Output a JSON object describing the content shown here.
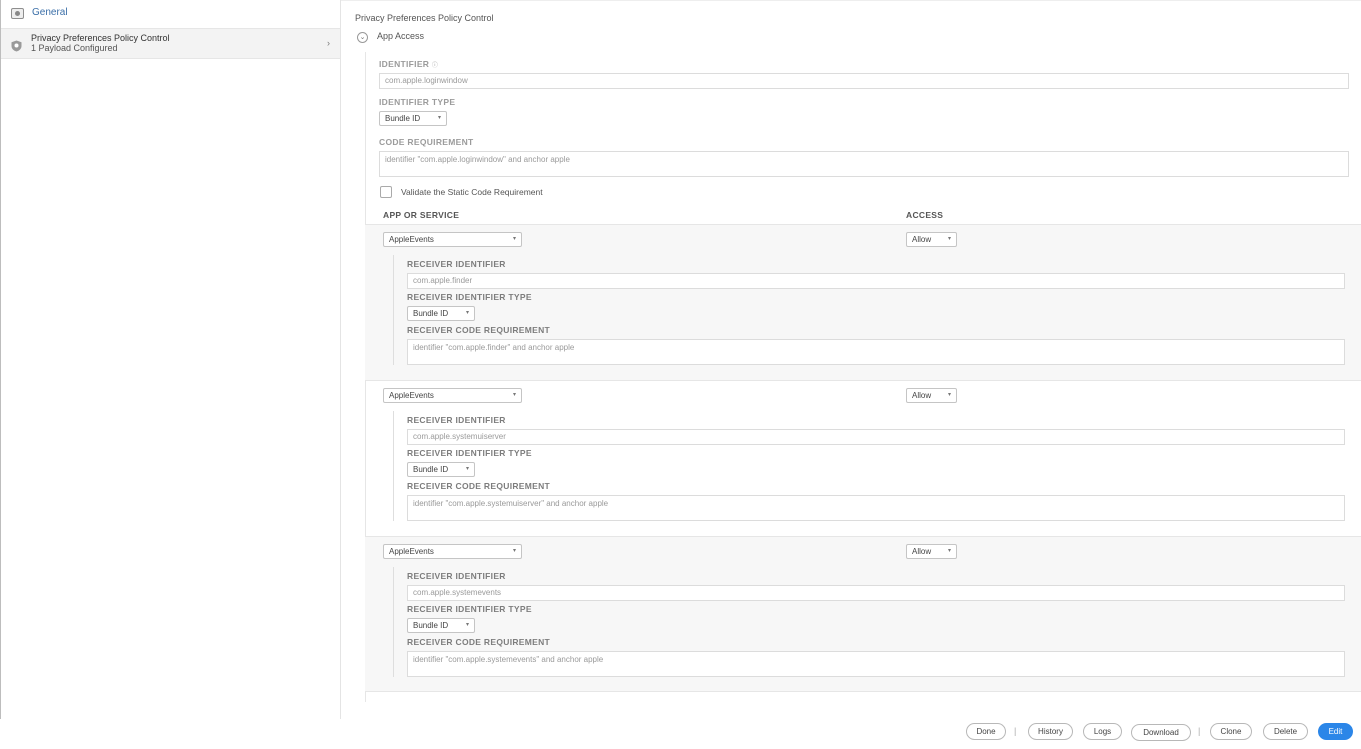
{
  "sidebar": {
    "general_label": "General",
    "ppc": {
      "title": "Privacy Preferences Policy Control",
      "subtitle": "1 Payload Configured"
    }
  },
  "main": {
    "payload_title": "Privacy Preferences Policy Control",
    "section_title": "App Access",
    "identifier": {
      "label": "IDENTIFIER",
      "value": "com.apple.loginwindow"
    },
    "identifier_type": {
      "label": "IDENTIFIER TYPE",
      "value": "Bundle ID"
    },
    "code_requirement": {
      "label": "CODE REQUIREMENT",
      "value": "identifier \"com.apple.loginwindow\" and anchor apple"
    },
    "validate_label": "Validate the Static Code Requirement",
    "columns": {
      "app_or_service": "APP OR SERVICE",
      "access": "ACCESS"
    },
    "rows": [
      {
        "service": "AppleEvents",
        "access": "Allow",
        "receiver_identifier_label": "RECEIVER IDENTIFIER",
        "receiver_identifier": "com.apple.finder",
        "receiver_identifier_type_label": "RECEIVER IDENTIFIER TYPE",
        "receiver_identifier_type": "Bundle ID",
        "receiver_code_requirement_label": "RECEIVER CODE REQUIREMENT",
        "receiver_code_requirement": "identifier \"com.apple.finder\" and anchor apple"
      },
      {
        "service": "AppleEvents",
        "access": "Allow",
        "receiver_identifier_label": "RECEIVER IDENTIFIER",
        "receiver_identifier": "com.apple.systemuiserver",
        "receiver_identifier_type_label": "RECEIVER IDENTIFIER TYPE",
        "receiver_identifier_type": "Bundle ID",
        "receiver_code_requirement_label": "RECEIVER CODE REQUIREMENT",
        "receiver_code_requirement": "identifier \"com.apple.systemuiserver\" and anchor apple"
      },
      {
        "service": "AppleEvents",
        "access": "Allow",
        "receiver_identifier_label": "RECEIVER IDENTIFIER",
        "receiver_identifier": "com.apple.systemevents",
        "receiver_identifier_type_label": "RECEIVER IDENTIFIER TYPE",
        "receiver_identifier_type": "Bundle ID",
        "receiver_code_requirement_label": "RECEIVER CODE REQUIREMENT",
        "receiver_code_requirement": "identifier \"com.apple.systemevents\" and anchor apple"
      }
    ]
  },
  "footer": {
    "done": "Done",
    "history": "History",
    "logs": "Logs",
    "download": "Download",
    "clone": "Clone",
    "delete": "Delete",
    "edit": "Edit",
    "separator": "|"
  },
  "colors": {
    "primary_button": "#2b86e8",
    "sidebar_link": "#3b6fa8"
  },
  "icons": {
    "general": "general-settings-icon",
    "ppc": "shield-icon",
    "chevron": "chevron-right-icon",
    "collapse": "chevron-down-circle-icon",
    "dropdown": "caret-down-icon"
  }
}
